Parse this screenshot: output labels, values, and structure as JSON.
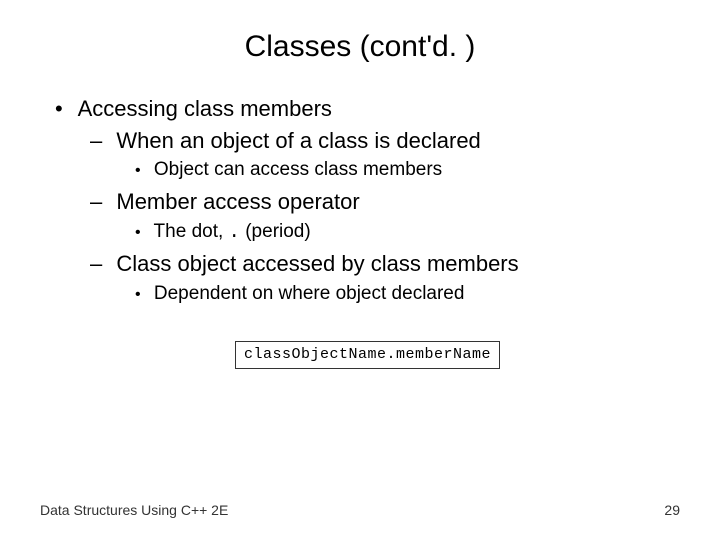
{
  "title": "Classes (cont'd. )",
  "bullets": {
    "l1_1": "Accessing class members",
    "l2_1": "When an object of a class is declared",
    "l3_1": "Object can access class members",
    "l2_2": "Member access operator",
    "l3_2_a": "The dot, ",
    "l3_2_b": ".",
    "l3_2_c": " (period)",
    "l2_3": "Class object accessed by class members",
    "l3_3": "Dependent on where object declared"
  },
  "code": "classObjectName.memberName",
  "footer": {
    "left": "Data Structures Using C++ 2E",
    "right": "29"
  }
}
